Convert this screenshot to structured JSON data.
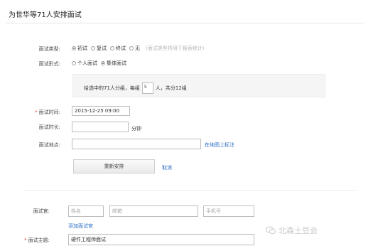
{
  "header": {
    "title": "为世华等71人安排面试"
  },
  "form": {
    "interview_type": {
      "label": "面试类型:",
      "options": [
        {
          "label": "初试",
          "checked": true
        },
        {
          "label": "复试",
          "checked": false
        },
        {
          "label": "终试",
          "checked": false
        },
        {
          "label": "无",
          "checked": false
        }
      ],
      "hint": "(面试类型将用于报表统计)"
    },
    "interview_form": {
      "label": "面试形式:",
      "options": [
        {
          "label": "个人面试",
          "checked": false
        },
        {
          "label": "集体面试",
          "checked": true
        }
      ]
    },
    "grouping": {
      "prefix": "给选中的71人分组，每组",
      "per_group": "5",
      "suffix": "人，共分12组"
    },
    "time": {
      "label": "面试时间:",
      "value": "2015-12-25 09:00",
      "required_mark": "*"
    },
    "duration": {
      "label": "面试时长:",
      "value": "",
      "unit": "分钟"
    },
    "location": {
      "label": "面试地点:",
      "value": "",
      "map_link": "在地图上标注"
    },
    "actions": {
      "rearrange_label": "重新安排",
      "cancel_label": "取消"
    },
    "interviewer": {
      "label": "面试官:",
      "name_placeholder": "姓名",
      "email_placeholder": "邮箱",
      "phone_placeholder": "手机号",
      "add_link": "添加面试官"
    },
    "subject": {
      "label": "面试主题:",
      "value": "硬件工程师面试",
      "required_mark": "*"
    }
  },
  "watermark": {
    "text": "北森土豆会"
  }
}
